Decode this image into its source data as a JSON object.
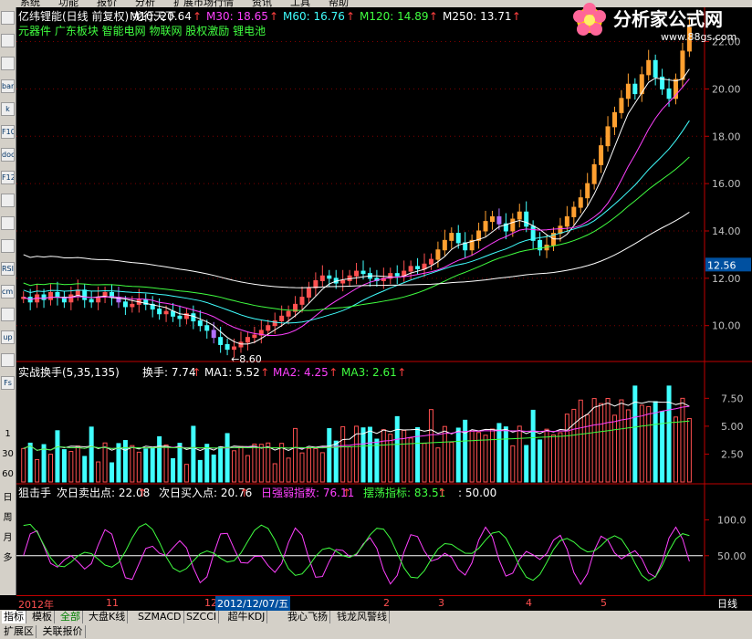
{
  "menu": {
    "items": [
      "系统",
      "功能",
      "报价",
      "分析",
      "扩展市场行情",
      "资讯",
      "工具",
      "帮助"
    ]
  },
  "logo": {
    "name": "分析家公式网",
    "url": "www.88gs.com"
  },
  "main_header": {
    "stock": "亿纬锂能(日线 前复权) 龙行天下",
    "ma": [
      {
        "label": "M10: 20.64",
        "color": "#ffffff"
      },
      {
        "label": "M30: 18.65",
        "color": "#ff40ff"
      },
      {
        "label": "M60: 16.76",
        "color": "#40ffff"
      },
      {
        "label": "M120: 14.89",
        "color": "#40ff40"
      },
      {
        "label": "M250: 13.71",
        "color": "#ffffff"
      }
    ],
    "concepts": "元器件 广东板块 智能电网 物联网 股权激励 锂电池"
  },
  "price_axis": [
    "22.00",
    "20.00",
    "18.00",
    "16.00",
    "14.00",
    "12.00",
    "10.00"
  ],
  "current_price": "12.56",
  "low_marker": "8.60",
  "vol_header": {
    "title": "实战换手(5,35,135)",
    "items": [
      {
        "label": "换手: 7.74",
        "color": "#ffffff"
      },
      {
        "label": "MA1: 5.52",
        "color": "#ffffff"
      },
      {
        "label": "MA2: 4.25",
        "color": "#ff40ff"
      },
      {
        "label": "MA3: 2.61",
        "color": "#40ff40"
      }
    ]
  },
  "vol_axis": [
    "7.50",
    "5.00",
    "2.50"
  ],
  "osc_header": {
    "title": "狙击手",
    "items": [
      {
        "label": "次日卖出点: 22.08",
        "color": "#ffffff"
      },
      {
        "label": "次日买入点: 20.76",
        "color": "#ffffff"
      },
      {
        "label": "日强弱指数: 76.11",
        "color": "#ff40ff"
      },
      {
        "label": "摆荡指标: 83.51",
        "color": "#40ff40"
      },
      {
        "label": ": 50.00",
        "color": "#ffffff"
      }
    ]
  },
  "osc_axis": [
    "100.0",
    "50.00"
  ],
  "date_axis": {
    "labels": [
      "2012年",
      "11",
      "12",
      "2",
      "3",
      "4",
      "5"
    ],
    "cursor": "2012/12/07/五",
    "period": "日线"
  },
  "left_labels": [
    "1",
    "30",
    "60",
    "日",
    "周",
    "月",
    "多"
  ],
  "toolbar_icons": [
    "minus",
    "chart",
    "line",
    "bar",
    "k",
    "F10",
    "doc",
    "F12",
    "cross",
    "zoom",
    "plus",
    "RSI",
    "cmp",
    "move",
    "up",
    "down",
    "Fs"
  ],
  "tabs_row1": [
    "指标",
    "模板",
    "全部",
    "大盘K线",
    "SZMACD",
    "SZCCI",
    "超牛KDJ",
    "我心飞扬",
    "钱龙风警线"
  ],
  "tabs_row2": [
    "扩展区",
    "关联报价"
  ],
  "chart_data": [
    {
      "type": "candlestick",
      "title": "亿纬锂能(日线 前复权)",
      "ylim": [
        8.6,
        22.6
      ],
      "note": "approximate daily close trend",
      "close": [
        11.2,
        11.0,
        11.3,
        11.1,
        11.4,
        11.2,
        11.0,
        11.3,
        11.5,
        11.1,
        11.0,
        11.2,
        11.4,
        11.2,
        11.0,
        10.8,
        10.9,
        11.1,
        10.9,
        10.7,
        10.5,
        10.6,
        10.4,
        10.3,
        10.5,
        10.2,
        10.0,
        9.8,
        9.5,
        9.2,
        9.0,
        9.1,
        9.3,
        9.5,
        9.6,
        9.8,
        10.0,
        10.2,
        10.4,
        10.6,
        10.9,
        11.2,
        11.6,
        11.9,
        12.1,
        12.0,
        11.8,
        11.9,
        12.1,
        12.3,
        12.2,
        12.0,
        11.9,
        12.0,
        12.2,
        12.1,
        12.3,
        12.5,
        12.4,
        12.6,
        12.8,
        13.2,
        13.6,
        13.9,
        13.5,
        13.2,
        13.6,
        14.0,
        14.4,
        14.6,
        14.3,
        14.0,
        14.5,
        14.8,
        14.2,
        13.6,
        13.2,
        13.4,
        13.9,
        14.2,
        14.6,
        15.0,
        15.4,
        16.0,
        16.8,
        17.6,
        18.4,
        19.0,
        19.6,
        20.2,
        19.8,
        20.6,
        21.2,
        20.5,
        20.0,
        19.6,
        20.4,
        21.6,
        22.6
      ],
      "series": [
        {
          "name": "M10",
          "last": 20.64
        },
        {
          "name": "M30",
          "last": 18.65
        },
        {
          "name": "M60",
          "last": 16.76
        },
        {
          "name": "M120",
          "last": 14.89
        },
        {
          "name": "M250",
          "last": 13.71
        }
      ]
    },
    {
      "type": "bar",
      "title": "实战换手(5,35,135)",
      "ylim": [
        0,
        9
      ],
      "series": [
        {
          "name": "换手",
          "last": 7.74
        },
        {
          "name": "MA1",
          "last": 5.52
        },
        {
          "name": "MA2",
          "last": 4.25
        },
        {
          "name": "MA3",
          "last": 2.61
        }
      ]
    },
    {
      "type": "line",
      "title": "狙击手",
      "ylim": [
        0,
        130
      ],
      "series": [
        {
          "name": "日强弱指数",
          "last": 76.11
        },
        {
          "name": "摆荡指标",
          "last": 83.51
        }
      ],
      "reference": 50.0
    }
  ]
}
